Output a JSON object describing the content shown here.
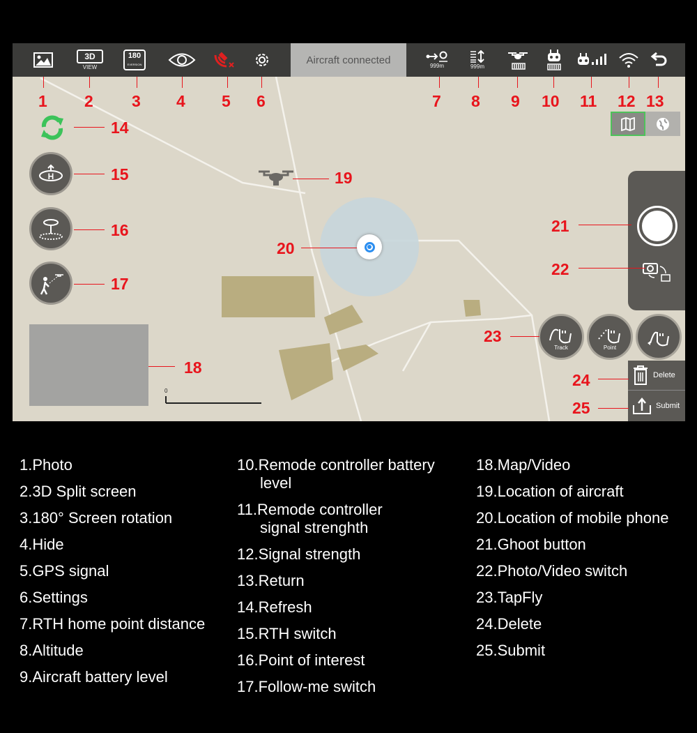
{
  "status": "Aircraft connected",
  "topbar": {
    "view_label": "VIEW",
    "rth_distance": "999m",
    "altitude": "999m",
    "rotation_label": "180",
    "rotation_sub": "EVERSION",
    "split_label": "3D"
  },
  "tapfly": {
    "track": "Track",
    "point": "Point"
  },
  "actions": {
    "delete": "Delete",
    "submit": "Submit"
  },
  "scale": {
    "zero": "0"
  },
  "colors": {
    "callout": "#e8141c",
    "topbar": "#3b3b39",
    "map": "#dcd7c9",
    "refresh": "#3cc35a",
    "gps": "#e02020",
    "location": "#2b8ef0"
  },
  "callouts": [
    "1",
    "2",
    "3",
    "4",
    "5",
    "6",
    "7",
    "8",
    "9",
    "10",
    "11",
    "12",
    "13",
    "14",
    "15",
    "16",
    "17",
    "18",
    "19",
    "20",
    "21",
    "22",
    "23",
    "24",
    "25"
  ],
  "legend": {
    "col1": [
      "1.Photo",
      "2.3D Split screen",
      "3.180° Screen rotation",
      "4.Hide",
      "5.GPS signal",
      "6.Settings",
      "7.RTH home point distance",
      "8.Altitude",
      "9.Aircraft battery level"
    ],
    "col2": [
      [
        "10.Remode controller battery",
        "level"
      ],
      [
        "11.Remode controller",
        "signal strenghth"
      ],
      [
        "12.Signal strength"
      ],
      [
        "13.Return"
      ],
      [
        "14.Refresh"
      ],
      [
        "15.RTH switch"
      ],
      [
        "16.Point of interest"
      ],
      [
        "17.Follow-me switch"
      ]
    ],
    "col3": [
      "18.Map/Video",
      "19.Location of aircraft",
      "20.Location of mobile phone",
      "21.Ghoot button",
      "22.Photo/Video switch",
      "23.TapFly",
      "24.Delete",
      "25.Submit"
    ]
  }
}
